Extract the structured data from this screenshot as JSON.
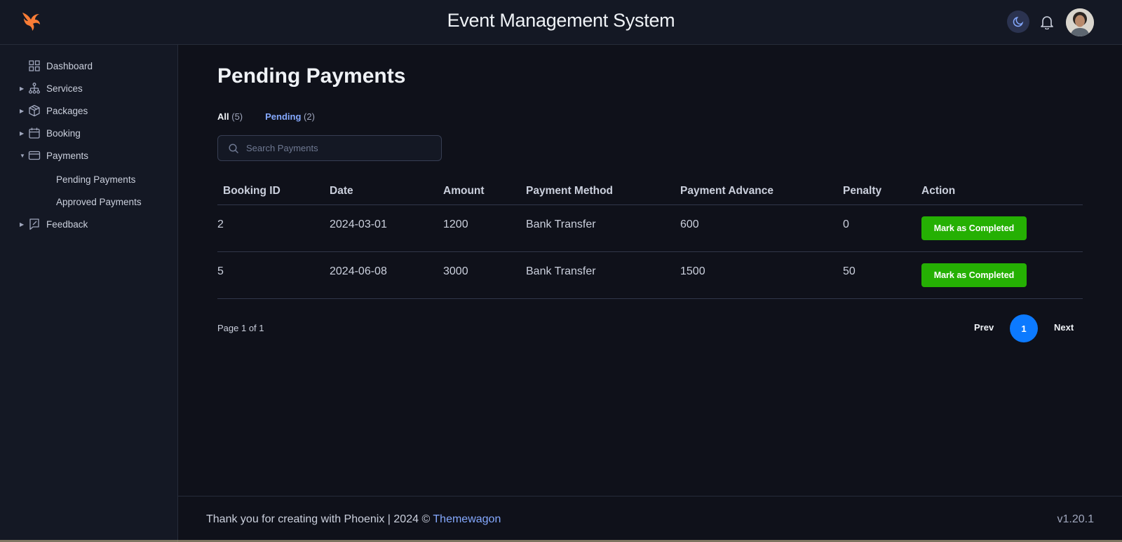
{
  "header": {
    "app_title": "Event Management System",
    "logo_icon": "phoenix-logo-icon",
    "theme_toggle_icon": "moon-icon",
    "notifications_icon": "bell-icon",
    "accent_color": "#f97c36"
  },
  "sidebar": {
    "items": [
      {
        "label": "Dashboard",
        "icon": "grid-icon",
        "expandable": false
      },
      {
        "label": "Services",
        "icon": "hierarchy-icon",
        "expandable": true,
        "expanded": false
      },
      {
        "label": "Packages",
        "icon": "box-icon",
        "expandable": true,
        "expanded": false
      },
      {
        "label": "Booking",
        "icon": "calendar-icon",
        "expandable": true,
        "expanded": false
      },
      {
        "label": "Payments",
        "icon": "credit-card-icon",
        "expandable": true,
        "expanded": true
      },
      {
        "label": "Feedback",
        "icon": "feedback-icon",
        "expandable": true,
        "expanded": false
      }
    ],
    "payments_children": [
      "Pending Payments",
      "Approved Payments"
    ]
  },
  "main": {
    "title": "Pending Payments",
    "tabs": [
      {
        "label": "All",
        "count": "(5)"
      },
      {
        "label": "Pending",
        "count": "(2)"
      }
    ],
    "search": {
      "placeholder": "Search Payments",
      "value": ""
    },
    "table": {
      "columns": [
        "Booking ID",
        "Date",
        "Amount",
        "Payment Method",
        "Payment Advance",
        "Penalty",
        "Action"
      ],
      "rows": [
        {
          "booking_id": "2",
          "date": "2024-03-01",
          "amount": "1200",
          "method": "Bank Transfer",
          "advance": "600",
          "penalty": "0",
          "action": "Mark as Completed"
        },
        {
          "booking_id": "5",
          "date": "2024-06-08",
          "amount": "3000",
          "method": "Bank Transfer",
          "advance": "1500",
          "penalty": "50",
          "action": "Mark as Completed"
        }
      ]
    },
    "pagination": {
      "info": "Page 1 of 1",
      "prev": "Prev",
      "current": "1",
      "next": "Next"
    }
  },
  "footer": {
    "text": "Thank you for creating with Phoenix | 2024 © ",
    "link": "Themewagon",
    "version": "v1.20.1"
  },
  "colors": {
    "success": "#25b003",
    "primary": "#0c7aff",
    "link": "#85a9ff"
  }
}
